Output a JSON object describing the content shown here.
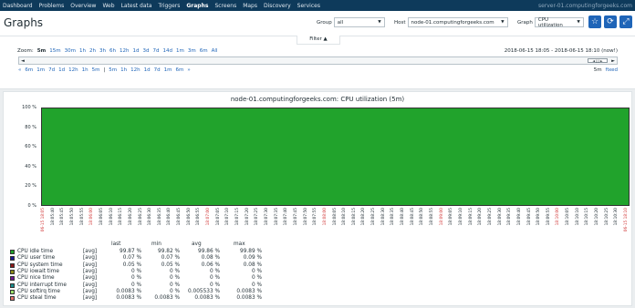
{
  "nav": {
    "items": [
      "Dashboard",
      "Problems",
      "Overview",
      "Web",
      "Latest data",
      "Triggers",
      "Graphs",
      "Screens",
      "Maps",
      "Discovery",
      "Services"
    ],
    "active": "Graphs",
    "server": "server-01.computingforgeeks.com"
  },
  "header": {
    "title": "Graphs",
    "group_label": "Group",
    "group_value": "all",
    "host_label": "Host",
    "host_value": "node-01.computingforgeeks.com",
    "graph_label": "Graph",
    "graph_value": "CPU utilization",
    "favorite_icon": "star-icon",
    "refresh_icon": "refresh-icon",
    "fullscreen_icon": "fullscreen-icon"
  },
  "filter": {
    "tab_label": "Filter ▲",
    "zoom_label": "Zoom:",
    "zoom_options": [
      "5m",
      "15m",
      "30m",
      "1h",
      "2h",
      "3h",
      "6h",
      "12h",
      "1d",
      "3d",
      "7d",
      "14d",
      "1m",
      "3m",
      "6m",
      "All"
    ],
    "zoom_active": "5m",
    "range_text": "2018-06-15 18:05 - 2018-06-15 18:10 (now!)",
    "nav_back": [
      "«",
      "6m",
      "1m",
      "7d",
      "1d",
      "12h",
      "1h",
      "5m"
    ],
    "nav_sep": "|",
    "nav_forward": [
      "5m",
      "1h",
      "12h",
      "1d",
      "7d",
      "1m",
      "6m",
      "»"
    ],
    "period_label": "5m",
    "fixed_label": "fixed",
    "scroll_left": "◄",
    "scroll_right": "►",
    "scroll_thumb": "◄ ||| ►"
  },
  "chart_data": {
    "type": "area",
    "title": "node-01.computingforgeeks.com: CPU utilization (5m)",
    "y_ticks": [
      "100 %",
      "80 %",
      "60 %",
      "40 %",
      "20 %",
      "0 %"
    ],
    "ylim": [
      0,
      100
    ],
    "x_ticks": [
      {
        "label": "06-15 18:05",
        "red": true
      },
      {
        "label": "18:05:40",
        "red": false
      },
      {
        "label": "18:05:45",
        "red": false
      },
      {
        "label": "18:05:50",
        "red": false
      },
      {
        "label": "18:05:55",
        "red": false
      },
      {
        "label": "18:06:00",
        "red": true
      },
      {
        "label": "18:06:05",
        "red": false
      },
      {
        "label": "18:06:10",
        "red": false
      },
      {
        "label": "18:06:15",
        "red": false
      },
      {
        "label": "18:06:20",
        "red": false
      },
      {
        "label": "18:06:25",
        "red": false
      },
      {
        "label": "18:06:30",
        "red": false
      },
      {
        "label": "18:06:35",
        "red": false
      },
      {
        "label": "18:06:40",
        "red": false
      },
      {
        "label": "18:06:45",
        "red": false
      },
      {
        "label": "18:06:50",
        "red": false
      },
      {
        "label": "18:06:55",
        "red": false
      },
      {
        "label": "18:07:00",
        "red": true
      },
      {
        "label": "18:07:05",
        "red": false
      },
      {
        "label": "18:07:10",
        "red": false
      },
      {
        "label": "18:07:15",
        "red": false
      },
      {
        "label": "18:07:20",
        "red": false
      },
      {
        "label": "18:07:25",
        "red": false
      },
      {
        "label": "18:07:30",
        "red": false
      },
      {
        "label": "18:07:35",
        "red": false
      },
      {
        "label": "18:07:40",
        "red": false
      },
      {
        "label": "18:07:45",
        "red": false
      },
      {
        "label": "18:07:50",
        "red": false
      },
      {
        "label": "18:07:55",
        "red": false
      },
      {
        "label": "18:08:00",
        "red": true
      },
      {
        "label": "18:08:05",
        "red": false
      },
      {
        "label": "18:08:10",
        "red": false
      },
      {
        "label": "18:08:15",
        "red": false
      },
      {
        "label": "18:08:20",
        "red": false
      },
      {
        "label": "18:08:25",
        "red": false
      },
      {
        "label": "18:08:30",
        "red": false
      },
      {
        "label": "18:08:35",
        "red": false
      },
      {
        "label": "18:08:40",
        "red": false
      },
      {
        "label": "18:08:45",
        "red": false
      },
      {
        "label": "18:08:50",
        "red": false
      },
      {
        "label": "18:08:55",
        "red": false
      },
      {
        "label": "18:09:00",
        "red": true
      },
      {
        "label": "18:09:05",
        "red": false
      },
      {
        "label": "18:09:10",
        "red": false
      },
      {
        "label": "18:09:15",
        "red": false
      },
      {
        "label": "18:09:20",
        "red": false
      },
      {
        "label": "18:09:25",
        "red": false
      },
      {
        "label": "18:09:30",
        "red": false
      },
      {
        "label": "18:09:35",
        "red": false
      },
      {
        "label": "18:09:40",
        "red": false
      },
      {
        "label": "18:09:45",
        "red": false
      },
      {
        "label": "18:09:50",
        "red": false
      },
      {
        "label": "18:09:55",
        "red": false
      },
      {
        "label": "18:10:00",
        "red": true
      },
      {
        "label": "18:10:05",
        "red": false
      },
      {
        "label": "18:10:10",
        "red": false
      },
      {
        "label": "18:10:15",
        "red": false
      },
      {
        "label": "18:10:20",
        "red": false
      },
      {
        "label": "18:10:25",
        "red": false
      },
      {
        "label": "18:10:30",
        "red": false
      },
      {
        "label": "06-15 18:10",
        "red": true
      }
    ],
    "series_fill_color": "#21a32c",
    "legend_headers": [
      "last",
      "min",
      "avg",
      "max"
    ],
    "legend": [
      {
        "name": "CPU idle time",
        "fn": "[avg]",
        "last": "99.87 %",
        "min": "99.82 %",
        "avg": "99.86 %",
        "max": "99.89 %",
        "color": "#21a32c"
      },
      {
        "name": "CPU user time",
        "fn": "[avg]",
        "last": "0.07 %",
        "min": "0.07 %",
        "avg": "0.08 %",
        "max": "0.09 %",
        "color": "#1a1a8c"
      },
      {
        "name": "CPU system time",
        "fn": "[avg]",
        "last": "0.05 %",
        "min": "0.05 %",
        "avg": "0.06 %",
        "max": "0.08 %",
        "color": "#8c1a1a"
      },
      {
        "name": "CPU iowait time",
        "fn": "[avg]",
        "last": "0 %",
        "min": "0 %",
        "avg": "0 %",
        "max": "0 %",
        "color": "#8c8c1a"
      },
      {
        "name": "CPU nice time",
        "fn": "[avg]",
        "last": "0 %",
        "min": "0 %",
        "avg": "0 %",
        "max": "0 %",
        "color": "#6a1a8c"
      },
      {
        "name": "CPU interrupt time",
        "fn": "[avg]",
        "last": "0 %",
        "min": "0 %",
        "avg": "0 %",
        "max": "0 %",
        "color": "#1a8c8c"
      },
      {
        "name": "CPU softirq time",
        "fn": "[avg]",
        "last": "0.0083 %",
        "min": "0 %",
        "avg": "0.005533 %",
        "max": "0.0083 %",
        "color": "#9ce06a"
      },
      {
        "name": "CPU steal time",
        "fn": "[avg]",
        "last": "0.0083 %",
        "min": "0.0083 %",
        "avg": "0.0083 %",
        "max": "0.0083 %",
        "color": "#e0706a"
      }
    ]
  }
}
